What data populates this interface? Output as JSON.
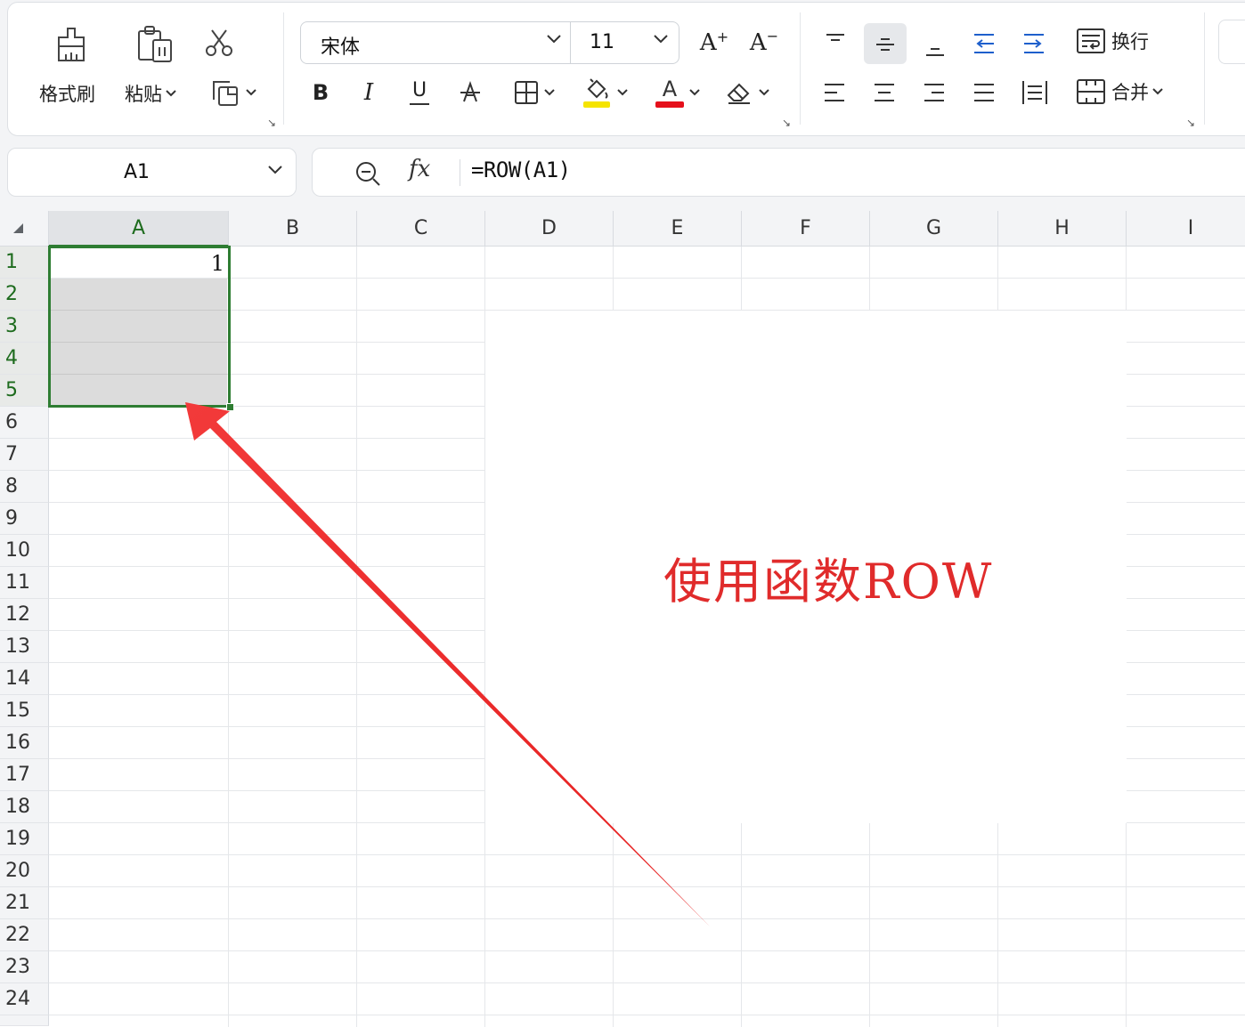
{
  "ribbon": {
    "format_painter_label": "格式刷",
    "paste_label": "粘贴",
    "font_name": "宋体",
    "font_size": "11",
    "increase_font_label": "A",
    "decrease_font_label": "A",
    "bold_label": "B",
    "italic_label": "I",
    "underline_label": "U",
    "font_color_label": "A",
    "wrap_text_label": "换行",
    "merge_label": "合并",
    "highlight_color": "#f5e400",
    "font_color": "#e5101b"
  },
  "formula_bar": {
    "cell_ref": "A1",
    "fx_label": "fx",
    "formula": "=ROW(A1)"
  },
  "sheet": {
    "columns": [
      "A",
      "B",
      "C",
      "D",
      "E",
      "F",
      "G",
      "H",
      "I"
    ],
    "rows": [
      "1",
      "2",
      "3",
      "4",
      "5",
      "6",
      "7",
      "8",
      "9",
      "10",
      "11",
      "12",
      "13",
      "14",
      "15",
      "16",
      "17",
      "18",
      "19",
      "20",
      "21",
      "22",
      "23",
      "24"
    ],
    "selected_column": "A",
    "selected_rows": [
      "1",
      "2",
      "3",
      "4",
      "5"
    ],
    "cell_a1_value": "1",
    "selection_color": "#2e7d32"
  },
  "annotation": {
    "text": "使用函数ROW",
    "color": "#e02b2b"
  }
}
